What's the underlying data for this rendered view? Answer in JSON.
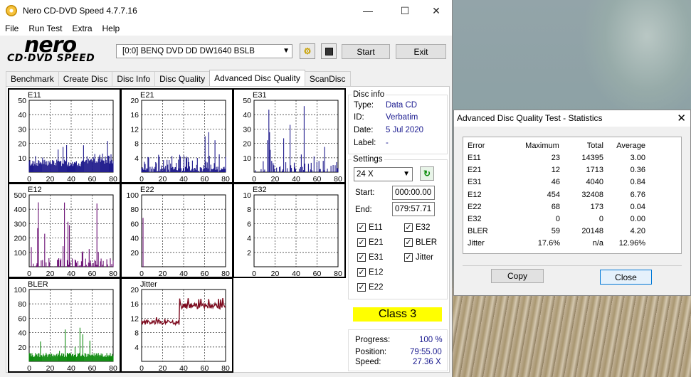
{
  "window": {
    "title": "Nero CD-DVD Speed 4.7.7.16",
    "controls": [
      "—",
      "☐",
      "✕"
    ],
    "menu": [
      "File",
      "Run Test",
      "Extra",
      "Help"
    ]
  },
  "logo": {
    "line1": "nero",
    "line2": "CD·DVD SPEED"
  },
  "toolbar": {
    "drive": "[0:0]   BENQ DVD DD DW1640 BSLB",
    "start_label": "Start",
    "exit_label": "Exit"
  },
  "tabs": [
    "Benchmark",
    "Create Disc",
    "Disc Info",
    "Disc Quality",
    "Advanced Disc Quality",
    "ScanDisc"
  ],
  "active_tab": "Advanced Disc Quality",
  "disc_info": {
    "legend": "Disc info",
    "type_label": "Type:",
    "type": "Data CD",
    "id_label": "ID:",
    "id": "Verbatim",
    "date_label": "Date:",
    "date": "5 Jul 2020",
    "label_label": "Label:",
    "label": "-"
  },
  "settings": {
    "legend": "Settings",
    "speed": "24 X",
    "start_label": "Start:",
    "start": "000:00.00",
    "end_label": "End:",
    "end": "079:57.71",
    "checks": [
      {
        "label": "E11",
        "checked": true
      },
      {
        "label": "E32",
        "checked": true
      },
      {
        "label": "E21",
        "checked": true
      },
      {
        "label": "BLER",
        "checked": true
      },
      {
        "label": "E31",
        "checked": true
      },
      {
        "label": "Jitter",
        "checked": true
      },
      {
        "label": "E12",
        "checked": true
      },
      {
        "label": "E22",
        "checked": true
      }
    ]
  },
  "class_label": "Class 3",
  "status": {
    "progress_label": "Progress:",
    "progress": "100 %",
    "position_label": "Position:",
    "position": "79:55.00",
    "speed_label": "Speed:",
    "speed": "27.36 X"
  },
  "colors": {
    "bar_e1": "#1f1a8c",
    "bar_e2": "#6b0f74",
    "bler": "#0e8a0e",
    "jitter": "#7d0a1e",
    "class_bg": "#ffff00"
  },
  "chart_data": [
    {
      "type": "bar",
      "title": "E11",
      "xlim": [
        0,
        80
      ],
      "ylim": [
        0,
        50
      ],
      "yticks": [
        10,
        20,
        30,
        40,
        50
      ],
      "xticks": [
        0,
        20,
        40,
        60,
        80
      ],
      "color": "#1f1a8c",
      "max": 23
    },
    {
      "type": "bar",
      "title": "E21",
      "xlim": [
        0,
        80
      ],
      "ylim": [
        0,
        20
      ],
      "yticks": [
        4,
        8,
        12,
        16,
        20
      ],
      "xticks": [
        0,
        20,
        40,
        60,
        80
      ],
      "color": "#1f1a8c",
      "max": 12
    },
    {
      "type": "bar",
      "title": "E31",
      "xlim": [
        0,
        80
      ],
      "ylim": [
        0,
        50
      ],
      "yticks": [
        10,
        20,
        30,
        40,
        50
      ],
      "xticks": [
        0,
        20,
        40,
        60,
        80
      ],
      "color": "#1f1a8c",
      "max": 46
    },
    {
      "type": "bar",
      "title": "E12",
      "xlim": [
        0,
        80
      ],
      "ylim": [
        0,
        500
      ],
      "yticks": [
        100,
        200,
        300,
        400,
        500
      ],
      "xticks": [
        0,
        20,
        40,
        60,
        80
      ],
      "color": "#6b0f74",
      "max": 454
    },
    {
      "type": "bar",
      "title": "E22",
      "xlim": [
        0,
        80
      ],
      "ylim": [
        0,
        100
      ],
      "yticks": [
        20,
        40,
        60,
        80,
        100
      ],
      "xticks": [
        0,
        20,
        40,
        60,
        80
      ],
      "color": "#6b0f74",
      "max": 68
    },
    {
      "type": "bar",
      "title": "E32",
      "xlim": [
        0,
        80
      ],
      "ylim": [
        0,
        10
      ],
      "yticks": [
        2,
        4,
        6,
        8,
        10
      ],
      "xticks": [
        0,
        20,
        40,
        60,
        80
      ],
      "color": "#6b0f74",
      "max": 0
    },
    {
      "type": "bar",
      "title": "BLER",
      "xlim": [
        0,
        80
      ],
      "ylim": [
        0,
        100
      ],
      "yticks": [
        20,
        40,
        60,
        80,
        100
      ],
      "xticks": [
        0,
        20,
        40,
        60,
        80
      ],
      "color": "#0e8a0e",
      "max": 59
    },
    {
      "type": "line",
      "title": "Jitter",
      "xlim": [
        0,
        80
      ],
      "ylim": [
        0,
        20
      ],
      "yticks": [
        4,
        8,
        12,
        16,
        20
      ],
      "xticks": [
        0,
        20,
        40,
        60,
        80
      ],
      "color": "#7d0a1e",
      "max": 17.6
    }
  ],
  "stats_dialog": {
    "title": "Advanced Disc Quality Test - Statistics",
    "headers": [
      "Error",
      "Maximum",
      "Total",
      "Average"
    ],
    "rows": [
      {
        "error": "E11",
        "maximum": "23",
        "total": "14395",
        "average": "3.00",
        "max_bg": "",
        "avg_bg": ""
      },
      {
        "error": "E21",
        "maximum": "12",
        "total": "1713",
        "average": "0.36",
        "max_bg": "",
        "avg_bg": ""
      },
      {
        "error": "E31",
        "maximum": "46",
        "total": "4040",
        "average": "0.84",
        "max_bg": "",
        "avg_bg": ""
      },
      {
        "error": "E12",
        "maximum": "454",
        "total": "32408",
        "average": "6.76",
        "max_bg": "",
        "avg_bg": ""
      },
      {
        "error": "E22",
        "maximum": "68",
        "total": "173",
        "average": "0.04",
        "max_bg": "#ffff00",
        "avg_bg": ""
      },
      {
        "error": "E32",
        "maximum": "0",
        "total": "0",
        "average": "0.00",
        "max_bg": "#22dd22",
        "avg_bg": ""
      },
      {
        "error": "BLER",
        "maximum": "59",
        "total": "20148",
        "average": "4.20",
        "max_bg": "#88ee22",
        "avg_bg": "#22dd22"
      },
      {
        "error": "Jitter",
        "maximum": "17.6%",
        "total": "n/a",
        "average": "12.96%",
        "max_bg": "",
        "avg_bg": ""
      }
    ],
    "copy_label": "Copy",
    "close_label": "Close"
  }
}
